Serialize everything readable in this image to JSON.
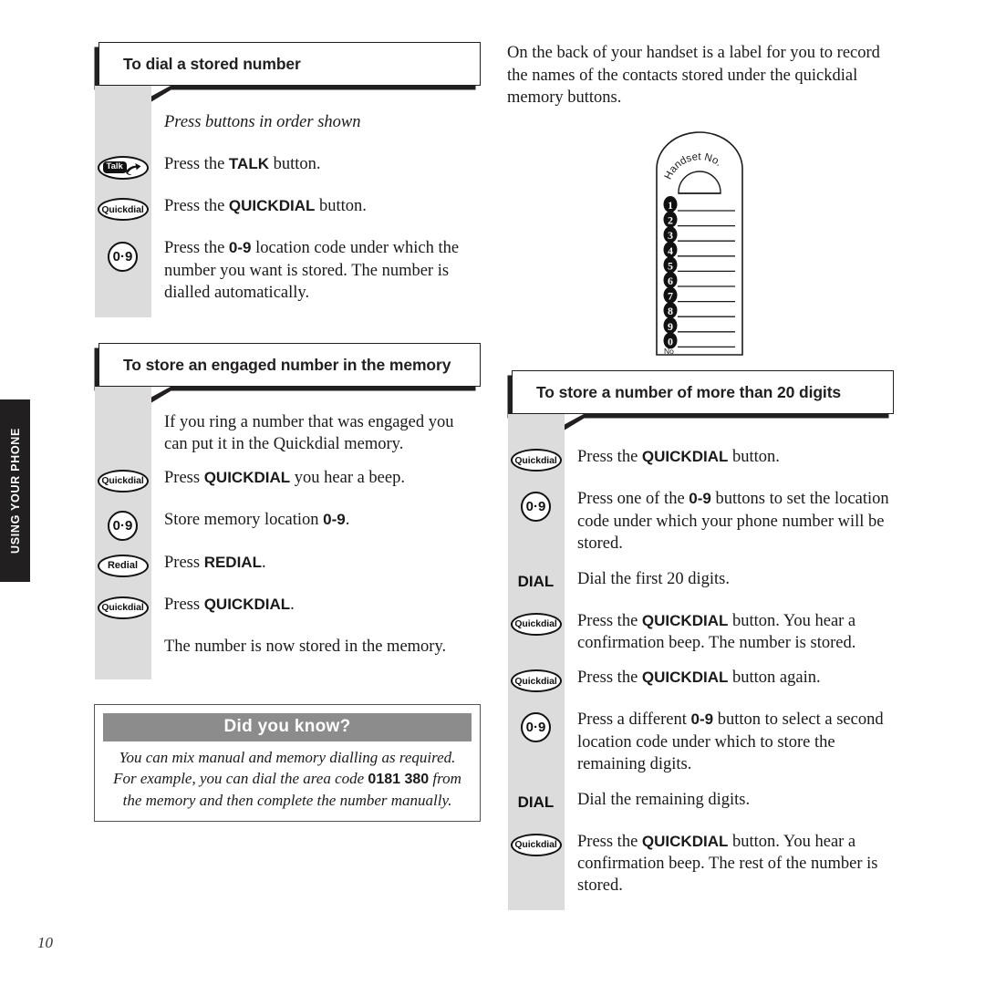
{
  "side_tab": {
    "label": "USING YOUR PHONE"
  },
  "page_number": "10",
  "left_column": {
    "section1": {
      "heading": "To dial a stored number",
      "steps": [
        {
          "icon": "none",
          "icon_label": "",
          "text": "Press buttons in order shown",
          "style": "italic"
        },
        {
          "icon": "talk-key",
          "icon_label": "Talk",
          "text": "Press the TALK button.",
          "bold_part": "TALK"
        },
        {
          "icon": "quickdial-key",
          "icon_label": "Quickdial",
          "text": "Press the QUICKDIAL button.",
          "bold_part": "QUICKDIAL"
        },
        {
          "icon": "zero-nine-key",
          "icon_label": "0·9",
          "text": "Press the 0-9 location code under which the number you want is stored. The number is dialled automatically.",
          "bold_part": "0-9"
        }
      ]
    },
    "section2": {
      "heading": "To store an engaged number in the memory",
      "steps": [
        {
          "icon": "none",
          "icon_label": "",
          "text": "If you ring a number that was engaged you can put it in the Quickdial memory."
        },
        {
          "icon": "quickdial-key",
          "icon_label": "Quickdial",
          "text": "Press QUICKDIAL you hear a beep.",
          "bold_part": "QUICKDIAL"
        },
        {
          "icon": "zero-nine-key",
          "icon_label": "0·9",
          "text": "Store memory location 0-9.",
          "bold_part": "0-9"
        },
        {
          "icon": "redial-key",
          "icon_label": "Redial",
          "text": "Press REDIAL.",
          "bold_part": "REDIAL"
        },
        {
          "icon": "quickdial-key",
          "icon_label": "Quickdial",
          "text": "Press QUICKDIAL.",
          "bold_part": "QUICKDIAL"
        },
        {
          "icon": "none",
          "icon_label": "",
          "text": "The number is now stored in the memory."
        }
      ]
    },
    "did_you_know": {
      "title": "Did you know?",
      "body_before": "You can mix manual and memory dialling as required. For example, you can dial the area code ",
      "body_bold": "0181 380",
      "body_after": " from the memory and then complete the number manually.",
      "bar_color": "#8c8c8c"
    }
  },
  "right_column": {
    "intro": "On the back of your handset is a label for you to record the names of the contacts stored under the quickdial memory buttons.",
    "handset_label": {
      "title": "Handset No.",
      "footer": "No",
      "rows": [
        "1",
        "2",
        "3",
        "4",
        "5",
        "6",
        "7",
        "8",
        "9",
        "0"
      ]
    },
    "section3": {
      "heading": "To store a number of more than 20 digits",
      "steps": [
        {
          "icon": "quickdial-key",
          "icon_label": "Quickdial",
          "text": "Press the QUICKDIAL button.",
          "bold_part": "QUICKDIAL"
        },
        {
          "icon": "zero-nine-key",
          "icon_label": "0·9",
          "text": "Press one of the 0-9 buttons to set the location code under which your phone number will be stored.",
          "bold_part": "0-9"
        },
        {
          "icon": "dial-key",
          "icon_label": "DIAL",
          "text": "Dial the first 20 digits."
        },
        {
          "icon": "quickdial-key",
          "icon_label": "Quickdial",
          "text": "Press the QUICKDIAL button. You hear a confirmation beep. The number is stored.",
          "bold_part": "QUICKDIAL"
        },
        {
          "icon": "quickdial-key",
          "icon_label": "Quickdial",
          "text": "Press the QUICKDIAL button again.",
          "bold_part": "QUICKDIAL"
        },
        {
          "icon": "zero-nine-key",
          "icon_label": "0·9",
          "text": "Press a different 0-9 button to select a second location code under which to store the remaining digits.",
          "bold_part": "0-9"
        },
        {
          "icon": "dial-key",
          "icon_label": "DIAL",
          "text": "Dial the remaining digits."
        },
        {
          "icon": "quickdial-key",
          "icon_label": "Quickdial",
          "text": "Press the QUICKDIAL button. You hear a confirmation beep. The rest of the number is stored.",
          "bold_part": "QUICKDIAL"
        }
      ]
    }
  }
}
